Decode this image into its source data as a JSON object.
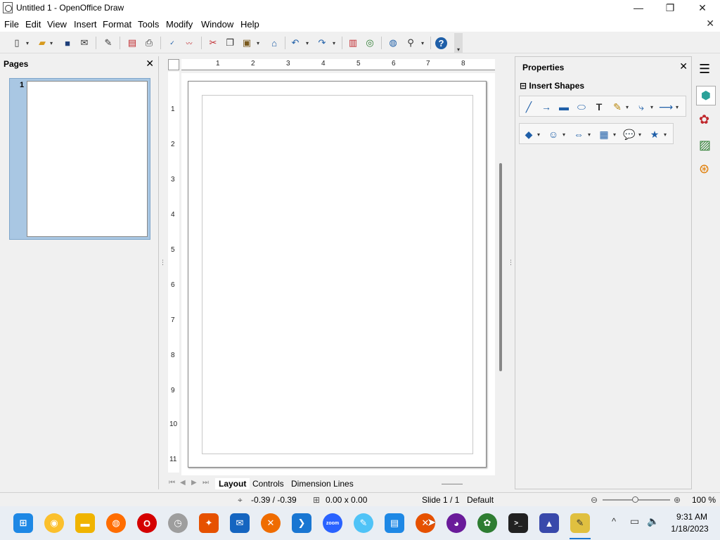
{
  "window": {
    "title": "Untitled 1 - OpenOffice Draw",
    "minimize": "—",
    "maximize": "❐",
    "close": "✕",
    "doc_close": "✕"
  },
  "menu": [
    "File",
    "Edit",
    "View",
    "Insert",
    "Format",
    "Tools",
    "Modify",
    "Window",
    "Help"
  ],
  "pages_panel": {
    "title": "Pages",
    "close": "✕",
    "page_number": "1"
  },
  "ruler": {
    "horizontal": [
      "1",
      "2",
      "3",
      "4",
      "5",
      "6",
      "7",
      "8"
    ],
    "vertical": [
      "1",
      "2",
      "3",
      "4",
      "5",
      "6",
      "7",
      "8",
      "9",
      "10",
      "11"
    ]
  },
  "tabs": [
    "Layout",
    "Controls",
    "Dimension Lines"
  ],
  "properties": {
    "title": "Properties",
    "close": "✕",
    "section": "Insert Shapes",
    "collapse": "⊟"
  },
  "status": {
    "position": "-0.39 / -0.39",
    "size": "0.00 x 0.00",
    "slide": "Slide 1 / 1",
    "master": "Default",
    "zoom": "100 %"
  },
  "taskbar": {
    "time": "9:31 AM",
    "date": "1/18/2023"
  }
}
